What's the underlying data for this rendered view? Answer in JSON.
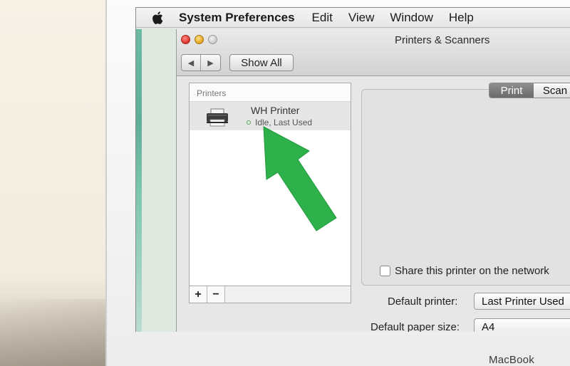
{
  "menubar": {
    "app_name": "System Preferences",
    "items": [
      "Edit",
      "View",
      "Window",
      "Help"
    ]
  },
  "window": {
    "title": "Printers & Scanners",
    "show_all_label": "Show All",
    "nav_back": "◀",
    "nav_forward": "▶"
  },
  "printers": {
    "header": "Printers",
    "items": [
      {
        "name": "WH Printer",
        "status": "Idle, Last Used"
      }
    ],
    "add_label": "+",
    "remove_label": "−"
  },
  "tabs": {
    "print": "Print",
    "scan": "Scan"
  },
  "share": {
    "label": "Share this printer on the network",
    "checked": false
  },
  "defaults": {
    "printer_label": "Default printer:",
    "printer_value": "Last Printer Used",
    "paper_label": "Default paper size:",
    "paper_value": "A4"
  },
  "device": {
    "label": "MacBook"
  },
  "colors": {
    "arrow": "#2eb04b",
    "status_dot": "#59a657",
    "selected_tab": "#7a7a7a"
  }
}
